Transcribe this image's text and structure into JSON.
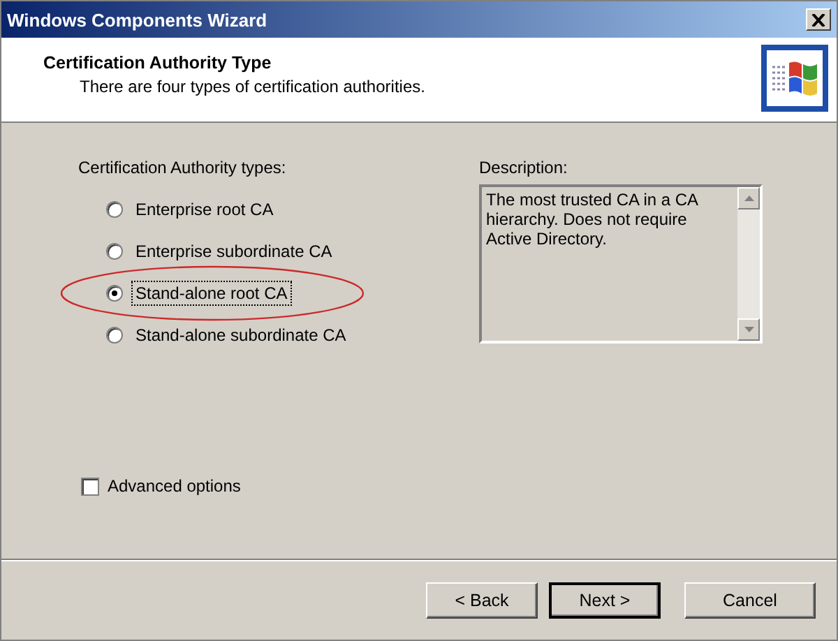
{
  "window": {
    "title": "Windows Components Wizard"
  },
  "header": {
    "title": "Certification Authority Type",
    "subtitle": "There are four types of certification authorities."
  },
  "types": {
    "label": "Certification Authority types:",
    "options": [
      {
        "label": "Enterprise root CA",
        "selected": false,
        "highlighted": false
      },
      {
        "label": "Enterprise subordinate CA",
        "selected": false,
        "highlighted": false
      },
      {
        "label": "Stand-alone root CA",
        "selected": true,
        "highlighted": true
      },
      {
        "label": "Stand-alone subordinate CA",
        "selected": false,
        "highlighted": false
      }
    ]
  },
  "description": {
    "label": "Description:",
    "text": "The most trusted CA in a CA hierarchy. Does not require Active Directory."
  },
  "advanced": {
    "label": "Advanced options",
    "checked": false
  },
  "buttons": [
    {
      "label": "< Back",
      "default": false
    },
    {
      "label": "Next >",
      "default": true
    },
    {
      "label": "Cancel",
      "default": false
    }
  ]
}
